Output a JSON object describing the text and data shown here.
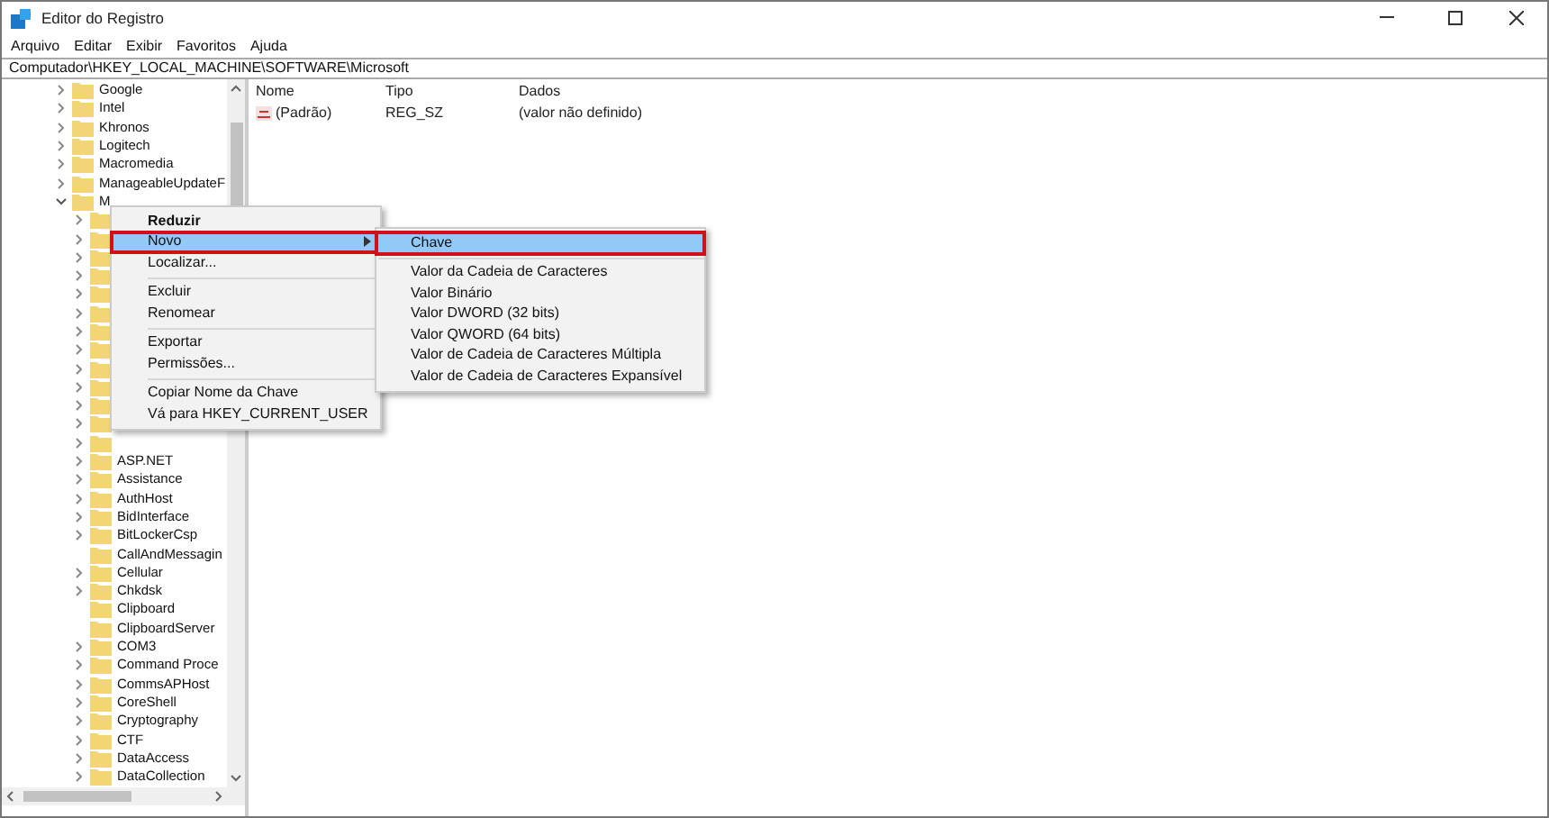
{
  "window": {
    "title": "Editor do Registro"
  },
  "menu_bar": [
    "Arquivo",
    "Editar",
    "Exibir",
    "Favoritos",
    "Ajuda"
  ],
  "address": "Computador\\HKEY_LOCAL_MACHINE\\SOFTWARE\\Microsoft",
  "tree": [
    {
      "label": "Google",
      "expandable": true
    },
    {
      "label": "Intel",
      "expandable": true
    },
    {
      "label": "Khronos",
      "expandable": true
    },
    {
      "label": "Logitech",
      "expandable": true
    },
    {
      "label": "Macromedia",
      "expandable": true
    },
    {
      "label": "ManageableUpdateF",
      "expandable": true
    },
    {
      "label": "M",
      "expandable": true,
      "expanded": true,
      "children": [
        {
          "label": "ASP.NET",
          "expandable": true
        },
        {
          "label": "Assistance",
          "expandable": true
        },
        {
          "label": "AuthHost",
          "expandable": true
        },
        {
          "label": "BidInterface",
          "expandable": true
        },
        {
          "label": "BitLockerCsp",
          "expandable": true
        },
        {
          "label": "CallAndMessagin",
          "expandable": false
        },
        {
          "label": "Cellular",
          "expandable": true
        },
        {
          "label": "Chkdsk",
          "expandable": true
        },
        {
          "label": "Clipboard",
          "expandable": false
        },
        {
          "label": "ClipboardServer",
          "expandable": false
        },
        {
          "label": "COM3",
          "expandable": true
        },
        {
          "label": "Command Proce",
          "expandable": true
        },
        {
          "label": "CommsAPHost",
          "expandable": true
        },
        {
          "label": "CoreShell",
          "expandable": true
        },
        {
          "label": "Cryptography",
          "expandable": true
        },
        {
          "label": "CTF",
          "expandable": true
        },
        {
          "label": "DataAccess",
          "expandable": true
        },
        {
          "label": "DataCollection",
          "expandable": true
        }
      ]
    }
  ],
  "values_table": {
    "columns": [
      "Nome",
      "Tipo",
      "Dados"
    ],
    "rows": [
      [
        "(Padrão)",
        "REG_SZ",
        "(valor não definido)"
      ]
    ]
  },
  "context_menu": {
    "items": [
      {
        "kind": "item",
        "label": "Reduzir",
        "bold": true,
        "selected": false,
        "outlined": false
      },
      {
        "kind": "item",
        "label": "Novo",
        "bold": false,
        "selected": true,
        "outlined": true,
        "has_submenu": true
      },
      {
        "kind": "item",
        "label": "Localizar...",
        "bold": false,
        "selected": false,
        "outlined": false
      },
      {
        "kind": "separator"
      },
      {
        "kind": "item",
        "label": "Excluir",
        "bold": false,
        "selected": false,
        "outlined": false
      },
      {
        "kind": "item",
        "label": "Renomear",
        "bold": false,
        "selected": false,
        "outlined": false
      },
      {
        "kind": "separator"
      },
      {
        "kind": "item",
        "label": "Exportar",
        "bold": false,
        "selected": false,
        "outlined": false
      },
      {
        "kind": "item",
        "label": "Permissões...",
        "bold": false,
        "selected": false,
        "outlined": false
      },
      {
        "kind": "separator"
      },
      {
        "kind": "item",
        "label": "Copiar Nome da Chave",
        "bold": false,
        "selected": false,
        "outlined": false
      },
      {
        "kind": "item",
        "label": "Vá para HKEY_CURRENT_USER",
        "bold": false,
        "selected": false,
        "outlined": false
      }
    ]
  },
  "submenu": {
    "items": [
      {
        "kind": "item",
        "label": "Chave",
        "selected": true,
        "outlined": true
      },
      {
        "kind": "separator"
      },
      {
        "kind": "item",
        "label": "Valor da Cadeia de Caracteres",
        "selected": false,
        "outlined": false
      },
      {
        "kind": "item",
        "label": "Valor Binário",
        "selected": false,
        "outlined": false
      },
      {
        "kind": "item",
        "label": "Valor DWORD (32 bits)",
        "selected": false,
        "outlined": false
      },
      {
        "kind": "item",
        "label": "Valor QWORD (64 bits)",
        "selected": false,
        "outlined": false
      },
      {
        "kind": "item",
        "label": "Valor de Cadeia de Caracteres Múltipla",
        "selected": false,
        "outlined": false
      },
      {
        "kind": "item",
        "label": "Valor de Cadeia de Caracteres Expansível",
        "selected": false,
        "outlined": false
      }
    ]
  }
}
